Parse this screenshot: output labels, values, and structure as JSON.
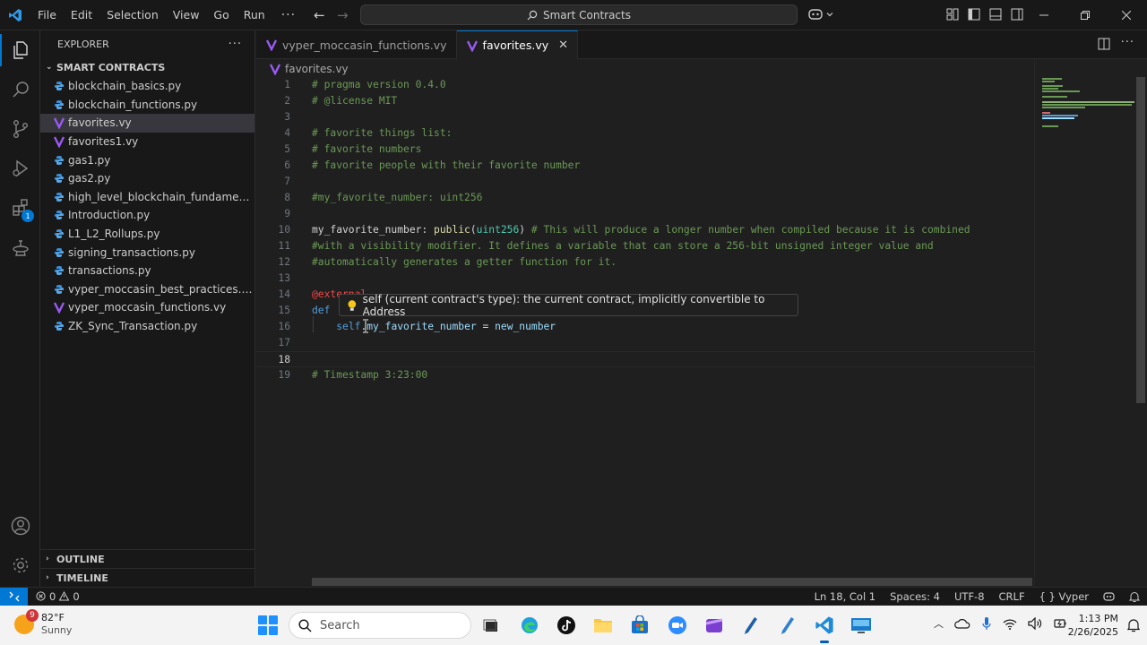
{
  "titlebar": {
    "menu": [
      "File",
      "Edit",
      "Selection",
      "View",
      "Go",
      "Run"
    ],
    "more": "···",
    "command_center": "Smart Contracts"
  },
  "explorer": {
    "title": "EXPLORER",
    "more": "···",
    "folder": "SMART CONTRACTS",
    "files": [
      {
        "name": "blockchain_basics.py",
        "icon": "python-file-icon"
      },
      {
        "name": "blockchain_functions.py",
        "icon": "python-file-icon"
      },
      {
        "name": "favorites.vy",
        "icon": "vyper-file-icon",
        "selected": true
      },
      {
        "name": "favorites1.vy",
        "icon": "vyper-file-icon"
      },
      {
        "name": "gas1.py",
        "icon": "python-file-icon"
      },
      {
        "name": "gas2.py",
        "icon": "python-file-icon"
      },
      {
        "name": "high_level_blockchain_fundamentals....",
        "icon": "python-file-icon"
      },
      {
        "name": "Introduction.py",
        "icon": "python-file-icon"
      },
      {
        "name": "L1_L2_Rollups.py",
        "icon": "python-file-icon"
      },
      {
        "name": "signing_transactions.py",
        "icon": "python-file-icon"
      },
      {
        "name": "transactions.py",
        "icon": "python-file-icon"
      },
      {
        "name": "vyper_moccasin_best_practices.py",
        "icon": "python-file-icon"
      },
      {
        "name": "vyper_moccasin_functions.vy",
        "icon": "vyper-file-icon"
      },
      {
        "name": "ZK_Sync_Transaction.py",
        "icon": "python-file-icon"
      }
    ],
    "outline": "OUTLINE",
    "timeline": "TIMELINE"
  },
  "activity_badge": "1",
  "tabs": [
    {
      "label": "vyper_moccasin_functions.vy",
      "active": false
    },
    {
      "label": "favorites.vy",
      "active": true,
      "close": "✕"
    }
  ],
  "breadcrumb": "favorites.vy",
  "editor": {
    "current_line": 18,
    "lines": [
      {
        "n": "1",
        "text": "# pragma version 0.4.0"
      },
      {
        "n": "2",
        "text": "# @license MIT"
      },
      {
        "n": "3",
        "text": ""
      },
      {
        "n": "4",
        "text": "# favorite things list:"
      },
      {
        "n": "5",
        "text": "# favorite numbers"
      },
      {
        "n": "6",
        "text": "# favorite people with their favorite number"
      },
      {
        "n": "7",
        "text": ""
      },
      {
        "n": "8",
        "text": "#my_favorite_number: uint256"
      },
      {
        "n": "9",
        "text": ""
      },
      {
        "n": "10",
        "text": "my_favorite_number: public(uint256) # This will produce a longer number when compiled because it is combined"
      },
      {
        "n": "11",
        "text": "#with a visibility modifier. It defines a variable that can store a 256-bit unsigned integer value and"
      },
      {
        "n": "12",
        "text": "#automatically generates a getter function for it."
      },
      {
        "n": "13",
        "text": ""
      },
      {
        "n": "14",
        "text": "@external"
      },
      {
        "n": "15",
        "text": "def"
      },
      {
        "n": "16",
        "text": "    self.my_favorite_number = new_number"
      },
      {
        "n": "17",
        "text": ""
      },
      {
        "n": "18",
        "text": ""
      },
      {
        "n": "19",
        "text": "# Timestamp 3:23:00"
      }
    ],
    "hover_text": "self (current contract's type): the current contract, implicitly convertible to Address"
  },
  "statusbar": {
    "errors": "0",
    "warnings": "0",
    "position": "Ln 18, Col 1",
    "spaces": "Spaces: 4",
    "encoding": "UTF-8",
    "eol": "CRLF",
    "language": "Vyper",
    "language_braces": "{ }"
  },
  "taskbar": {
    "weather_badge": "9",
    "temperature": "82°F",
    "condition": "Sunny",
    "search_placeholder": "Search",
    "time": "1:13 PM",
    "date": "2/26/2025"
  },
  "colors": {
    "accent": "#0078d4",
    "comment": "#6a9955",
    "keyword": "#569cd6",
    "vyper_icon": "#9b59f5",
    "python_icon": "#3b8fd6"
  }
}
